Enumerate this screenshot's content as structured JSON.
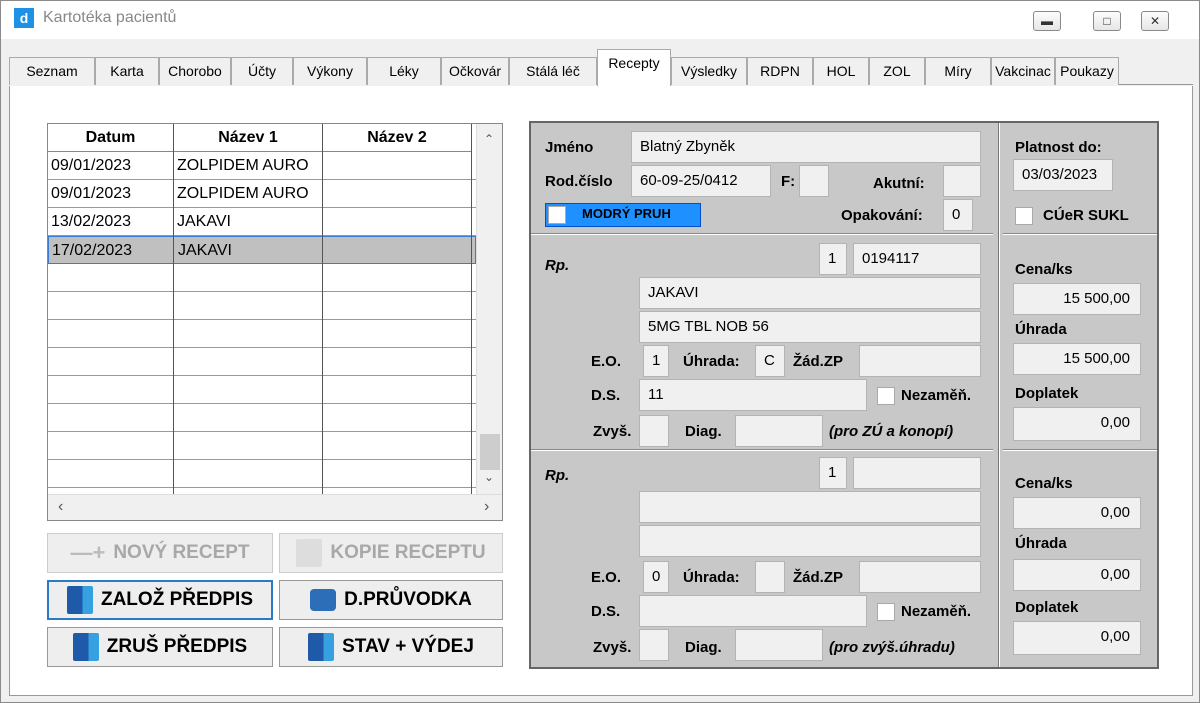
{
  "window": {
    "title": "Kartotéka pacientů",
    "icon_letter": "d",
    "controls": [
      "minimize-icon",
      "maximize-icon",
      "close-icon"
    ]
  },
  "tabs": [
    {
      "label": "Seznam"
    },
    {
      "label": "Karta"
    },
    {
      "label": "Chorobo"
    },
    {
      "label": "Účty"
    },
    {
      "label": "Výkony"
    },
    {
      "label": "Léky"
    },
    {
      "label": "Očkovár"
    },
    {
      "label": "Stálá léč"
    },
    {
      "label": "Recepty",
      "active": true
    },
    {
      "label": "Výsledky"
    },
    {
      "label": "RDPN"
    },
    {
      "label": "HOL"
    },
    {
      "label": "ZOL"
    },
    {
      "label": "Míry"
    },
    {
      "label": "Vakcinac"
    },
    {
      "label": "Poukazy"
    }
  ],
  "grid": {
    "columns": [
      "Datum",
      "Název 1",
      "Název 2"
    ],
    "rows": [
      {
        "datum": "09/01/2023",
        "nazev1": "ZOLPIDEM AURO",
        "nazev2": ""
      },
      {
        "datum": "09/01/2023",
        "nazev1": "ZOLPIDEM AURO",
        "nazev2": ""
      },
      {
        "datum": "13/02/2023",
        "nazev1": "JAKAVI",
        "nazev2": ""
      },
      {
        "datum": "17/02/2023",
        "nazev1": "JAKAVI",
        "nazev2": "",
        "selected": true
      }
    ]
  },
  "buttons": {
    "novy_recept": "NOVÝ RECEPT",
    "kopie_receptu": "KOPIE RECEPTU",
    "zaloz_predpis": "ZALOŽ PŘEDPIS",
    "d_pruvodka": "D.PRŮVODKA",
    "zrus_predpis": "ZRUŠ PŘEDPIS",
    "stav_vydej": "STAV + VÝDEJ"
  },
  "patient": {
    "jmeno_label": "Jméno",
    "jmeno": "Blatný Zbyněk",
    "rodcislo_label": "Rod.číslo",
    "rodcislo": "60-09-25/0412",
    "f_label": "F:",
    "f": "",
    "akutni_label": "Akutní:",
    "akutni": "",
    "modry_pruh": "MODRÝ PRUH",
    "opakovani_label": "Opakování:",
    "opakovani": "0",
    "platnost_label": "Platnost do:",
    "platnost": "03/03/2023",
    "cuer_label": "CÚeR SUKL"
  },
  "rp1": {
    "rp_label": "Rp.",
    "count": "1",
    "code": "0194117",
    "name1": "JAKAVI",
    "name2": "5MG TBL NOB 56",
    "eo_label": "E.O.",
    "eo": "1",
    "uhrada_label": "Úhrada:",
    "uhrada": "C",
    "zadzp_label": "Žád.ZP",
    "zadzp": "",
    "ds_label": "D.S.",
    "ds": "11",
    "nezamen_label": "Nezaměň.",
    "zvys_label": "Zvyš.",
    "zvys": "",
    "diag_label": "Diag.",
    "diag": "",
    "note": "(pro ZÚ a konopí)",
    "cena_label": "Cena/ks",
    "cena": "15 500,00",
    "uhrada2_label": "Úhrada",
    "uhrada2": "15 500,00",
    "doplatek_label": "Doplatek",
    "doplatek": "0,00"
  },
  "rp2": {
    "rp_label": "Rp.",
    "count": "1",
    "code": "",
    "name1": "",
    "name2": "",
    "eo_label": "E.O.",
    "eo": "0",
    "uhrada_label": "Úhrada:",
    "uhrada": "",
    "zadzp_label": "Žád.ZP",
    "zadzp": "",
    "ds_label": "D.S.",
    "ds": "",
    "nezamen_label": "Nezaměň.",
    "zvys_label": "Zvyš.",
    "zvys": "",
    "diag_label": "Diag.",
    "diag": "",
    "note": "(pro zvýš.úhradu)",
    "cena_label": "Cena/ks",
    "cena": "0,00",
    "uhrada2_label": "Úhrada",
    "uhrada2": "0,00",
    "doplatek_label": "Doplatek",
    "doplatek": "0,00"
  }
}
